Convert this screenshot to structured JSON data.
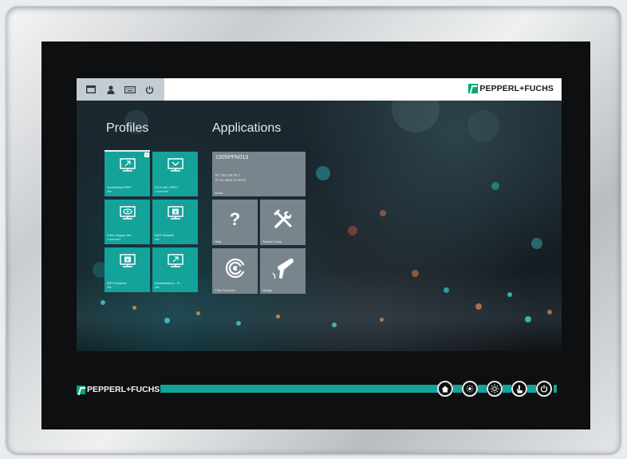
{
  "colors": {
    "accent_teal": "#13a39a",
    "app_tile_gray": "#78858c",
    "brand_green": "#00a878"
  },
  "topbar": {
    "icons": [
      "window-icon",
      "user-icon",
      "keyboard-icon",
      "power-icon"
    ],
    "brand": "PEPPERL+FUCHS"
  },
  "profiles": {
    "title": "Profiles",
    "tiles": [
      {
        "name": "Workstation RDP",
        "status": "Idle",
        "icon": "monitor-rdp-icon",
        "badge": "2"
      },
      {
        "name": "DCS with OPEC",
        "status": "Connected",
        "icon": "monitor-vnc-icon"
      },
      {
        "name": "Citrix Display Wo...",
        "status": "Connected",
        "icon": "monitor-eye-icon"
      },
      {
        "name": "MES Website",
        "status": "Idle",
        "icon": "monitor-browser-icon"
      },
      {
        "name": "MES Explorer",
        "status": "Idle",
        "icon": "monitor-explorer-icon"
      },
      {
        "name": "Workstation A - R...",
        "status": "Idle",
        "icon": "monitor-rdp-icon"
      }
    ]
  },
  "applications": {
    "title": "Applications",
    "about": {
      "name": "1305PFN013",
      "ip": "IP: 192.168.75.1",
      "datetime": "07.04.2016 17:49:54",
      "label": "About"
    },
    "tiles": [
      {
        "label": "Help",
        "icon": "question-mark-icon",
        "glyph": "?"
      },
      {
        "label": "System Tools",
        "icon": "tools-icon"
      },
      {
        "label": "Citrix Receiver",
        "icon": "citrix-receiver-icon"
      },
      {
        "label": "Wedge",
        "icon": "barcode-scanner-icon"
      }
    ]
  },
  "bezel": {
    "brand": "PEPPERL+FUCHS",
    "buttons": [
      "home-icon",
      "brightness-down-icon",
      "brightness-up-icon",
      "touch-icon",
      "power-icon"
    ]
  }
}
